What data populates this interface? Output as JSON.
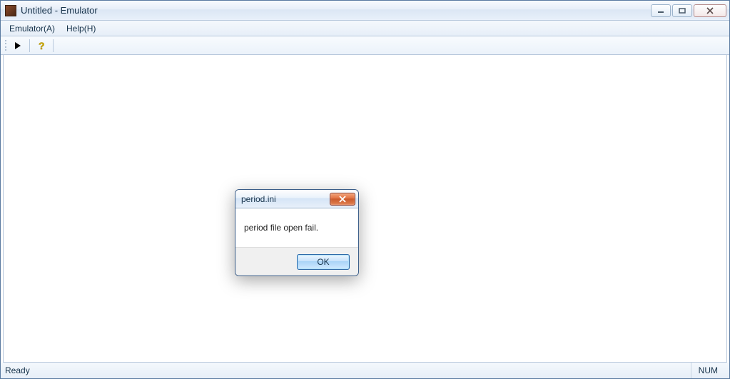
{
  "window": {
    "title": "Untitled - Emulator"
  },
  "menu": {
    "emulator": "Emulator(A)",
    "help": "Help(H)"
  },
  "toolbar": {
    "play_icon": "play-icon",
    "help_icon": "help-icon"
  },
  "statusbar": {
    "ready": "Ready",
    "num": "NUM"
  },
  "dialog": {
    "title": "period.ini",
    "message": "period file open fail.",
    "ok_label": "OK"
  }
}
